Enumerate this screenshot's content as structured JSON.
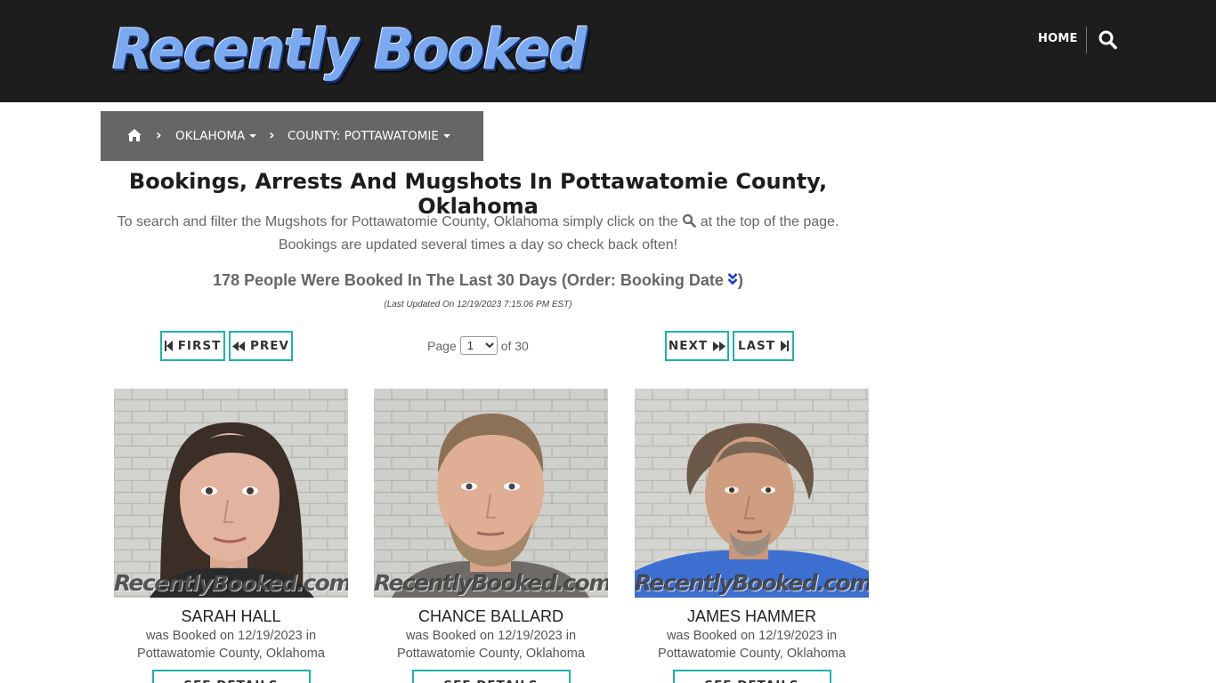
{
  "header": {
    "logo_text": "Recently Booked",
    "nav_home": "HOME"
  },
  "breadcrumb": {
    "state": "OKLAHOMA",
    "county": "COUNTY: POTTAWATOMIE"
  },
  "main": {
    "title": "Bookings, Arrests And Mugshots In Pottawatomie County, Oklahoma",
    "intro_before": "To search and filter the Mugshots for Pottawatomie County, Oklahoma simply click on the",
    "intro_after": "at the top of the page. Bookings are updated several times a day so check back often!",
    "count_text": "178 People Were Booked In The Last 30 Days (Order: Booking Date",
    "count_close": ")",
    "last_updated": "(Last Updated On 12/19/2023 7:15:06 PM EST)"
  },
  "pagination": {
    "first": "FIRST",
    "prev": "PREV",
    "next": "NEXT",
    "last": "LAST",
    "page_label": "Page",
    "current_page": "1",
    "of_label": "of 30"
  },
  "bookings": [
    {
      "name": "SARAH HALL",
      "booked_line": "was Booked on 12/19/2023 in",
      "location": "Pottawatomie County, Oklahoma",
      "watermark": "RecentlyBooked.com",
      "button": "SEE DETAILS"
    },
    {
      "name": "CHANCE BALLARD",
      "booked_line": "was Booked on 12/19/2023 in",
      "location": "Pottawatomie County, Oklahoma",
      "watermark": "RecentlyBooked.com",
      "button": "SEE DETAILS"
    },
    {
      "name": "JAMES HAMMER",
      "booked_line": "was Booked on 12/19/2023 in",
      "location": "Pottawatomie County, Oklahoma",
      "watermark": "RecentlyBooked.com",
      "button": "SEE DETAILS"
    }
  ],
  "colors": {
    "header_bg": "#1d1d1d",
    "breadcrumb_bg": "#666666",
    "accent_border": "#20b2aa",
    "sort_icon": "#1a3cc8"
  },
  "icons": {
    "nav_search": "search-icon",
    "breadcrumb_home": "home-icon",
    "sort": "double-chevron-down-icon"
  }
}
